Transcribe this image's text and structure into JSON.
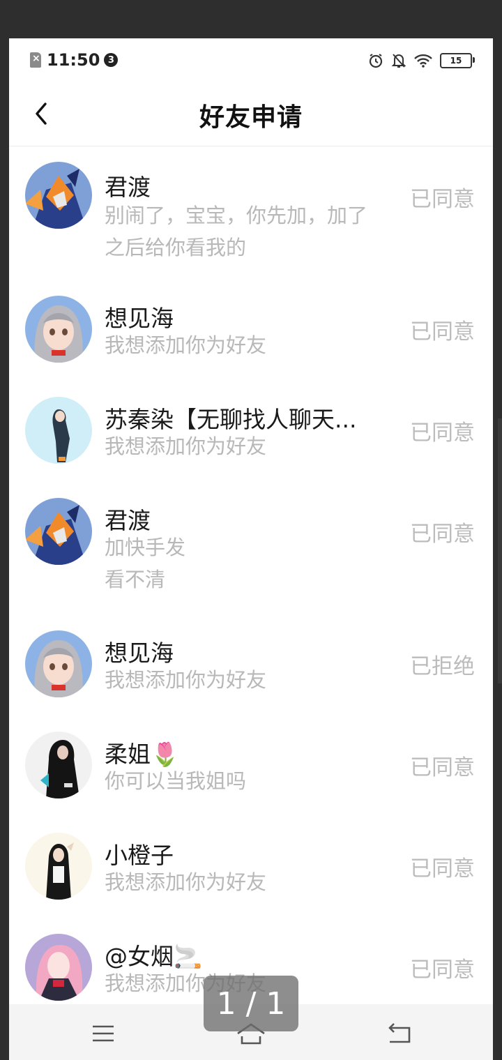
{
  "status_bar": {
    "time": "11:50",
    "notification_count": "3",
    "battery": "15"
  },
  "header": {
    "title": "好友申请"
  },
  "requests": [
    {
      "name": "君渡",
      "message_line1": "别闹了，宝宝，你先加，加了",
      "message_line2": "之后给你看我的",
      "status": "已同意",
      "avatar": "mecha-blue-orange"
    },
    {
      "name": "想见海",
      "message_line1": "我想添加你为好友",
      "message_line2": "",
      "status": "已同意",
      "avatar": "grey-hair-girl"
    },
    {
      "name": "苏秦染【无聊找人聊天...",
      "message_line1": "我想添加你为好友",
      "message_line2": "",
      "status": "已同意",
      "avatar": "dark-figure-light-blue"
    },
    {
      "name": "君渡",
      "message_line1": "加快手发",
      "message_line2": "看不清",
      "status": "已同意",
      "avatar": "mecha-blue-orange"
    },
    {
      "name": "想见海",
      "message_line1": "我想添加你为好友",
      "message_line2": "",
      "status": "已拒绝",
      "avatar": "grey-hair-girl"
    },
    {
      "name": "柔姐🌷",
      "message_line1": "你可以当我姐吗",
      "message_line2": "",
      "status": "已同意",
      "avatar": "black-hood-figure"
    },
    {
      "name": "小橙子",
      "message_line1": "我想添加你为好友",
      "message_line2": "",
      "status": "已同意",
      "avatar": "black-hair-girl"
    },
    {
      "name": "@女烟🚬",
      "message_line1": "我想添加你为好友",
      "message_line2": "",
      "status": "已同意",
      "avatar": "pink-hair-girl"
    }
  ],
  "page_indicator": "1 / 1",
  "colors": {
    "status_text": "#bcbcbc",
    "message_text": "#b8b8b8",
    "name_text": "#1a1a1a"
  }
}
